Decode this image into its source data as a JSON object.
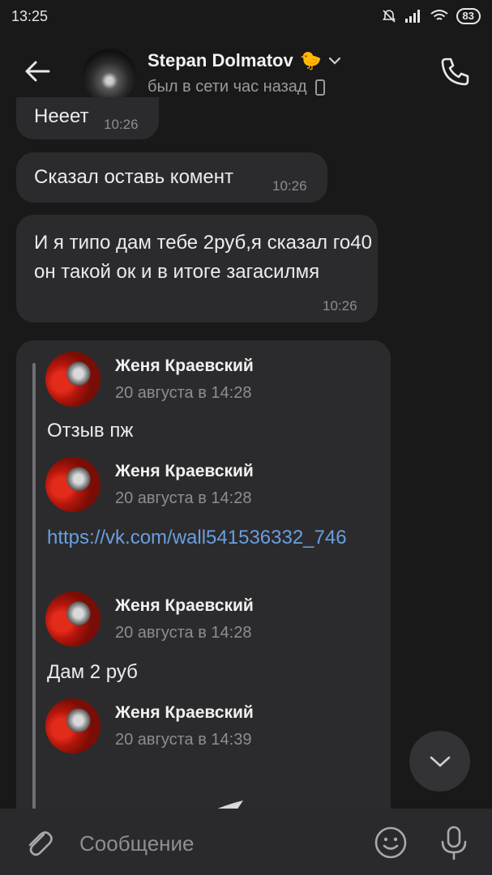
{
  "status_bar": {
    "time": "13:25",
    "battery": "83"
  },
  "header": {
    "name": "Stepan Dolmatov",
    "status": "был в сети час назад"
  },
  "messages": [
    {
      "text": "Нееет",
      "time": "10:26"
    },
    {
      "text": "Сказал оставь комент",
      "time": "10:26"
    },
    {
      "text": "И я типо дам тебе 2руб,я сказал го40 он такой ок и в итоге загасилмя",
      "time": "10:26"
    }
  ],
  "forwarded": [
    {
      "author": "Женя Краевский",
      "date": "20 августа в 14:28",
      "text": "Отзыв пж"
    },
    {
      "author": "Женя Краевский",
      "date": "20 августа в 14:28",
      "link": "https://vk.com/wall541536332_746"
    },
    {
      "author": "Женя Краевский",
      "date": "20 августа в 14:28",
      "text": "Дам 2 руб"
    },
    {
      "author": "Женя Краевский",
      "date": "20 августа в 14:39"
    }
  ],
  "composer": {
    "placeholder": "Сообщение"
  },
  "icons": {
    "back": "arrow-left-icon",
    "call": "phone-icon",
    "attach": "paperclip-icon",
    "emoji": "emoji-icon",
    "mic": "microphone-icon",
    "scroll": "chevron-down-icon"
  },
  "colors": {
    "background": "#19191a",
    "bubble": "#2b2b2d",
    "link": "#6a9fe0",
    "secondary_text": "#8d8d92"
  }
}
